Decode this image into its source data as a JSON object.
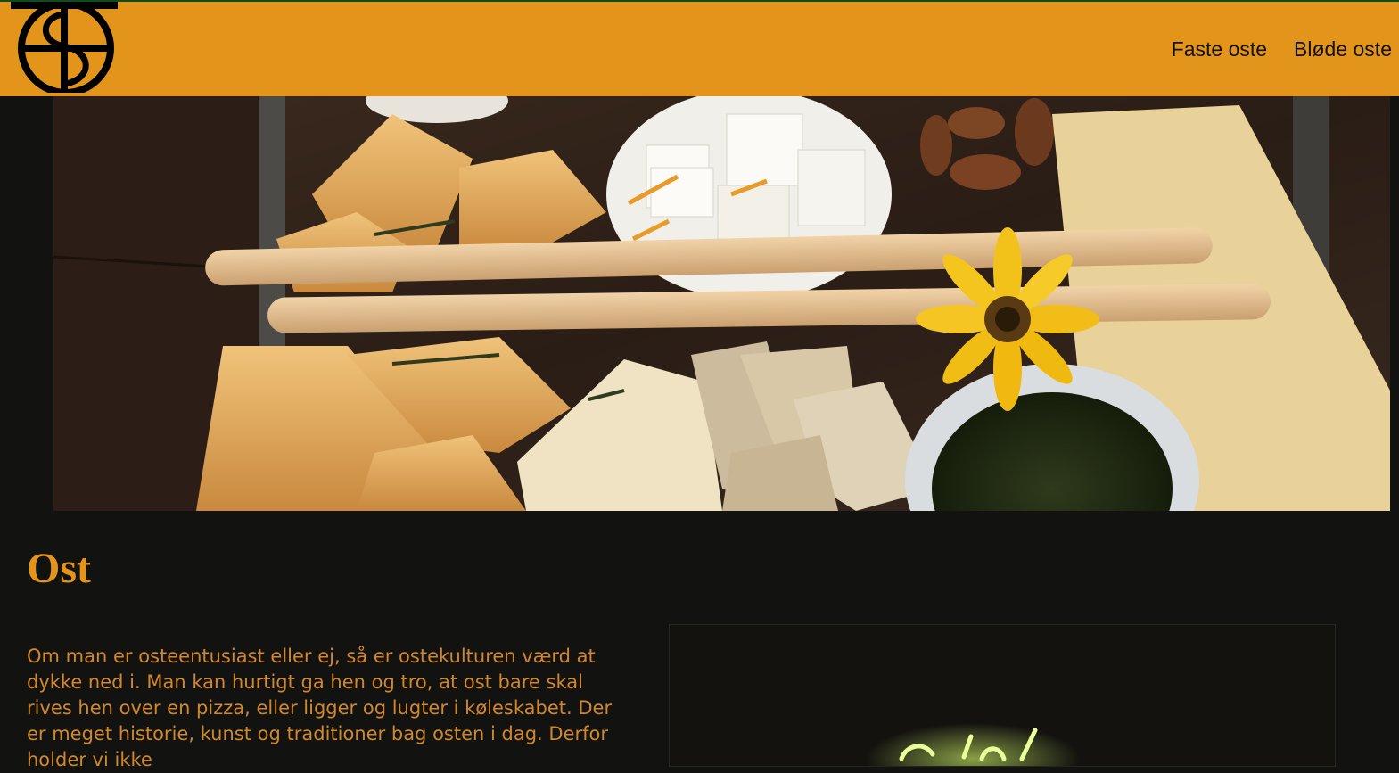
{
  "header": {
    "logo_icon": "cheese-wheel-logo-icon",
    "nav": [
      {
        "label": "Faste oste"
      },
      {
        "label": "Bløde oste"
      }
    ]
  },
  "hero": {
    "image": "cheese-board-photo"
  },
  "main": {
    "title": "Ost",
    "intro": "Om man er osteentusiast eller ej, så er ostekulturen værd at dykke ned i. Man kan hurtigt ga hen og tro, at ost bare skal rives hen over en pizza, eller ligger og lugter i køleskabet. Der er meget historie, kunst og traditioner bag osten i dag. Derfor holder vi ikke"
  },
  "media": {
    "image": "video-thumbnail-neon"
  },
  "colors": {
    "header_bg": "#E3951B",
    "page_bg": "#121210",
    "accent": "#E3951B",
    "body_text": "#D2872A"
  }
}
